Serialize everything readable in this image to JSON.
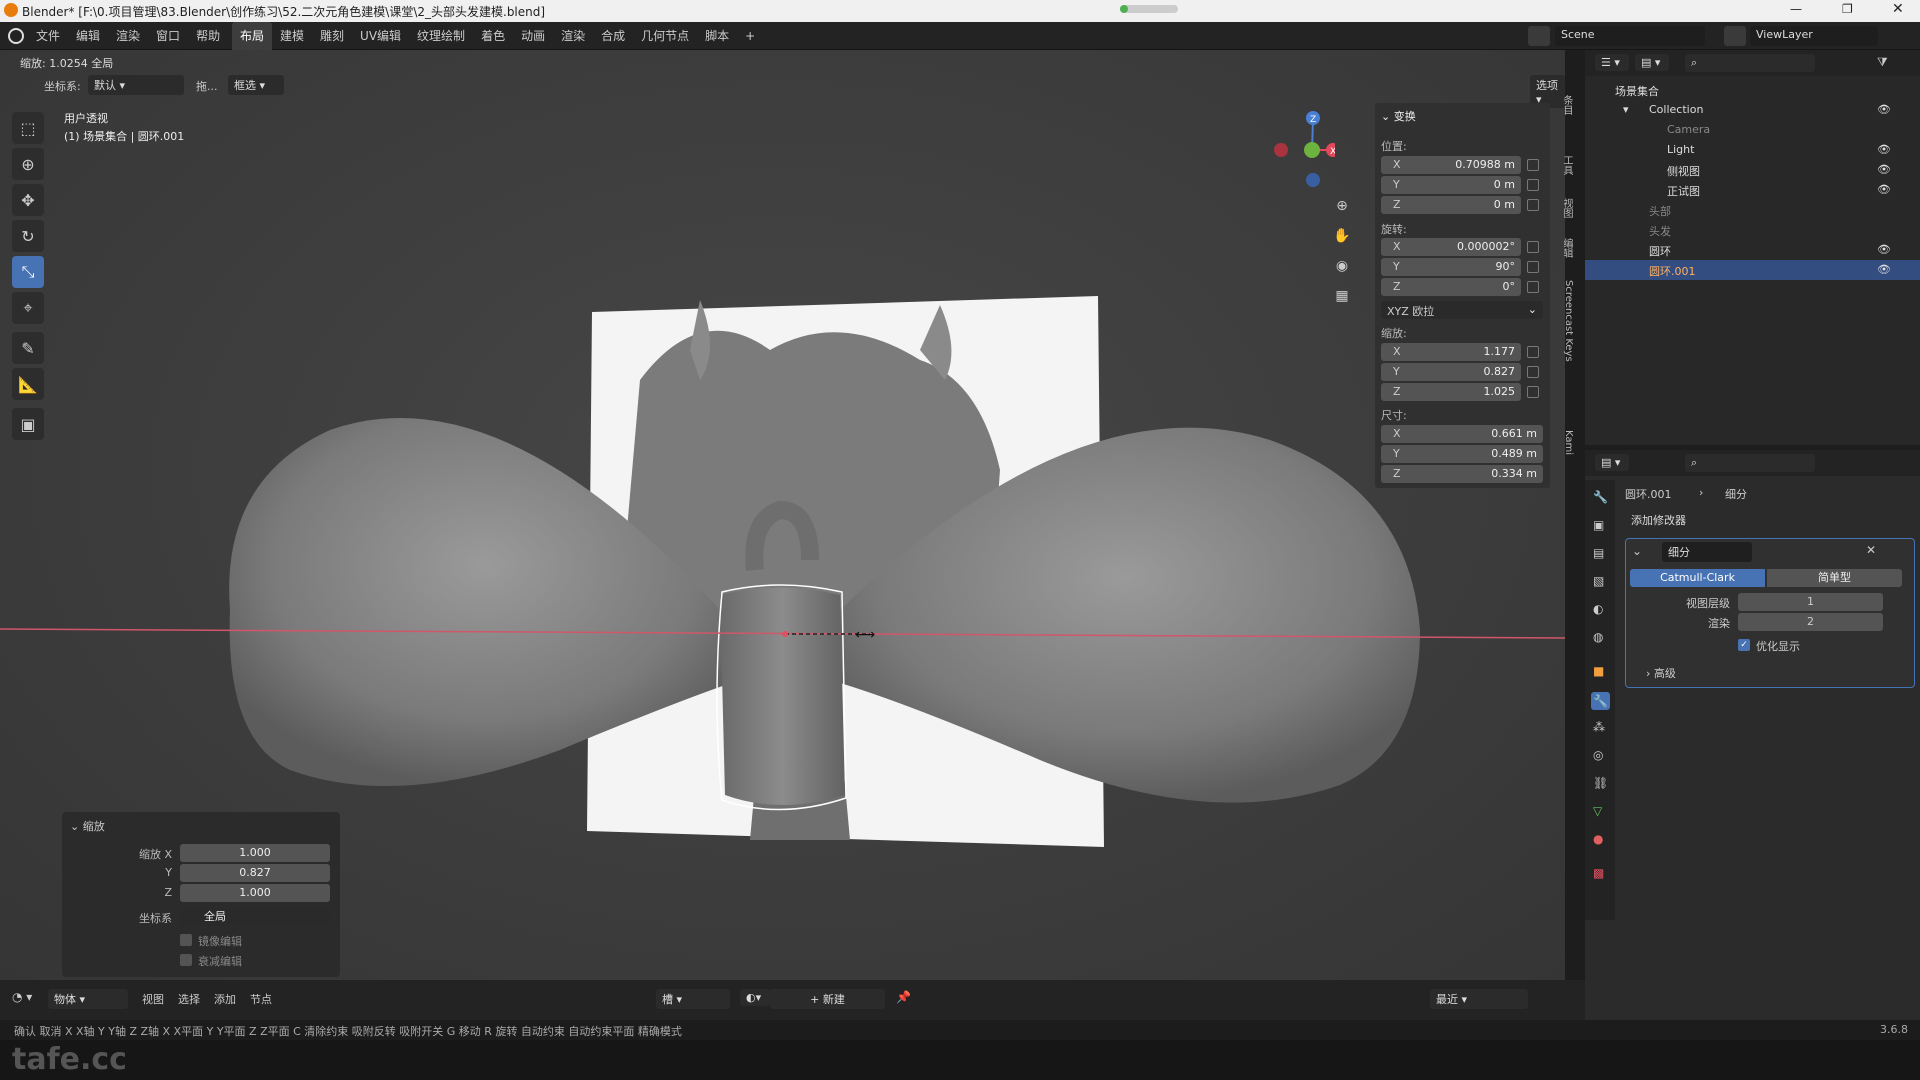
{
  "titlebar": {
    "title": "Blender* [F:\\0.项目管理\\83.Blender\\创作练习\\52.二次元角色建模\\课堂\\2_头部头发建模.blend]"
  },
  "menu": {
    "items": [
      "文件",
      "编辑",
      "渲染",
      "窗口",
      "帮助"
    ]
  },
  "workspaces": {
    "tabs": [
      "布局",
      "建模",
      "雕刻",
      "UV编辑",
      "纹理绘制",
      "着色",
      "动画",
      "渲染",
      "合成",
      "几何节点",
      "脚本"
    ],
    "active": "布局",
    "add": "+"
  },
  "scene": {
    "label": "Scene",
    "viewlayer": "ViewLayer"
  },
  "viewport_header": {
    "status": "缩放: 1.0254 全局",
    "coord_label": "坐标系:",
    "coord_value": "默认",
    "drag_label": "拖...",
    "select_value": "框选",
    "options": "选项"
  },
  "viewport": {
    "view_name": "用户透视",
    "context": "(1) 场景集合 | 圆环.001"
  },
  "npanel": {
    "section": "变换",
    "location_label": "位置:",
    "location": {
      "x": "0.70988 m",
      "y": "0 m",
      "z": "0 m"
    },
    "rotation_label": "旋转:",
    "rotation": {
      "x": "0.000002°",
      "y": "90°",
      "z": "0°"
    },
    "rotation_mode": "XYZ 欧拉",
    "scale_label": "缩放:",
    "scale": {
      "x": "1.177",
      "y": "0.827",
      "z": "1.025"
    },
    "dimensions_label": "尺寸:",
    "dimensions": {
      "x": "0.661 m",
      "y": "0.489 m",
      "z": "0.334 m"
    },
    "side_tabs": [
      "条目",
      "工具",
      "视图",
      "编辑",
      "Screencast Keys",
      "Kami"
    ]
  },
  "axis_labels": {
    "x": "X",
    "y": "Y",
    "z": "Z"
  },
  "outliner": {
    "root": "场景集合",
    "rows": [
      {
        "name": "Collection",
        "indent": 1
      },
      {
        "name": "Camera",
        "indent": 2
      },
      {
        "name": "Light",
        "indent": 2
      },
      {
        "name": "侧视图",
        "indent": 2
      },
      {
        "name": "正试图",
        "indent": 2
      },
      {
        "name": "头部",
        "indent": 1
      },
      {
        "name": "头发",
        "indent": 1
      },
      {
        "name": "圆环",
        "indent": 1
      },
      {
        "name": "圆环.001",
        "indent": 1
      }
    ],
    "selected": "圆环.001"
  },
  "properties": {
    "object": "圆环.001",
    "modifier_tab": "细分",
    "add_modifier": "添加修改器",
    "modifier_name": "细分",
    "mode_a": "Catmull-Clark",
    "mode_b": "简单型",
    "levels_viewport_label": "视图层级",
    "levels_viewport": "1",
    "render_label": "渲染",
    "render_value": "2",
    "optimal_display": "优化显示",
    "advanced": "高级"
  },
  "last_operator": {
    "title": "缩放",
    "scale_x_label": "缩放 X",
    "scale_x": "1.000",
    "y_label": "Y",
    "scale_y": "0.827",
    "z_label": "Z",
    "scale_z": "1.000",
    "coord_label": "坐标系",
    "coord_value": "全局",
    "mirror": "镜像编辑",
    "falloff": "衰减编辑"
  },
  "bottombar": {
    "mode": "物体",
    "items": [
      "视图",
      "选择",
      "添加",
      "节点"
    ],
    "slot": "槽",
    "new": "新建",
    "snap": "最近"
  },
  "statusbar": {
    "hints": "确认   取消   X X轴   Y Y轴   Z Z轴   X X平面   Y Y平面   Z Z平面   C 清除约束   吸附反转   吸附开关   G 移动   R 旋转   自动约束   自动约束平面   精确模式",
    "version": "3.6.8"
  },
  "watermark": "tafe.cc"
}
